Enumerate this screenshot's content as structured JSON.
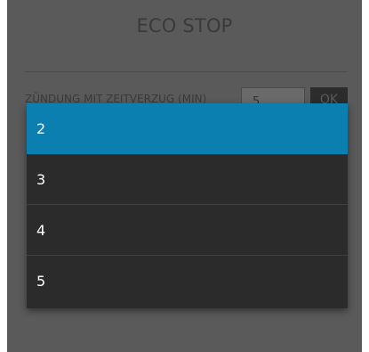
{
  "header": {
    "title": "ECO STOP"
  },
  "setting": {
    "label": "ZÜNDUNG MIT ZEITVERZUG (MIN)",
    "value": "5",
    "ok_label": "OK"
  },
  "dropdown": {
    "options": [
      "2",
      "3",
      "4",
      "5"
    ],
    "selected": "2",
    "accent_color": "#0a7fb0"
  }
}
